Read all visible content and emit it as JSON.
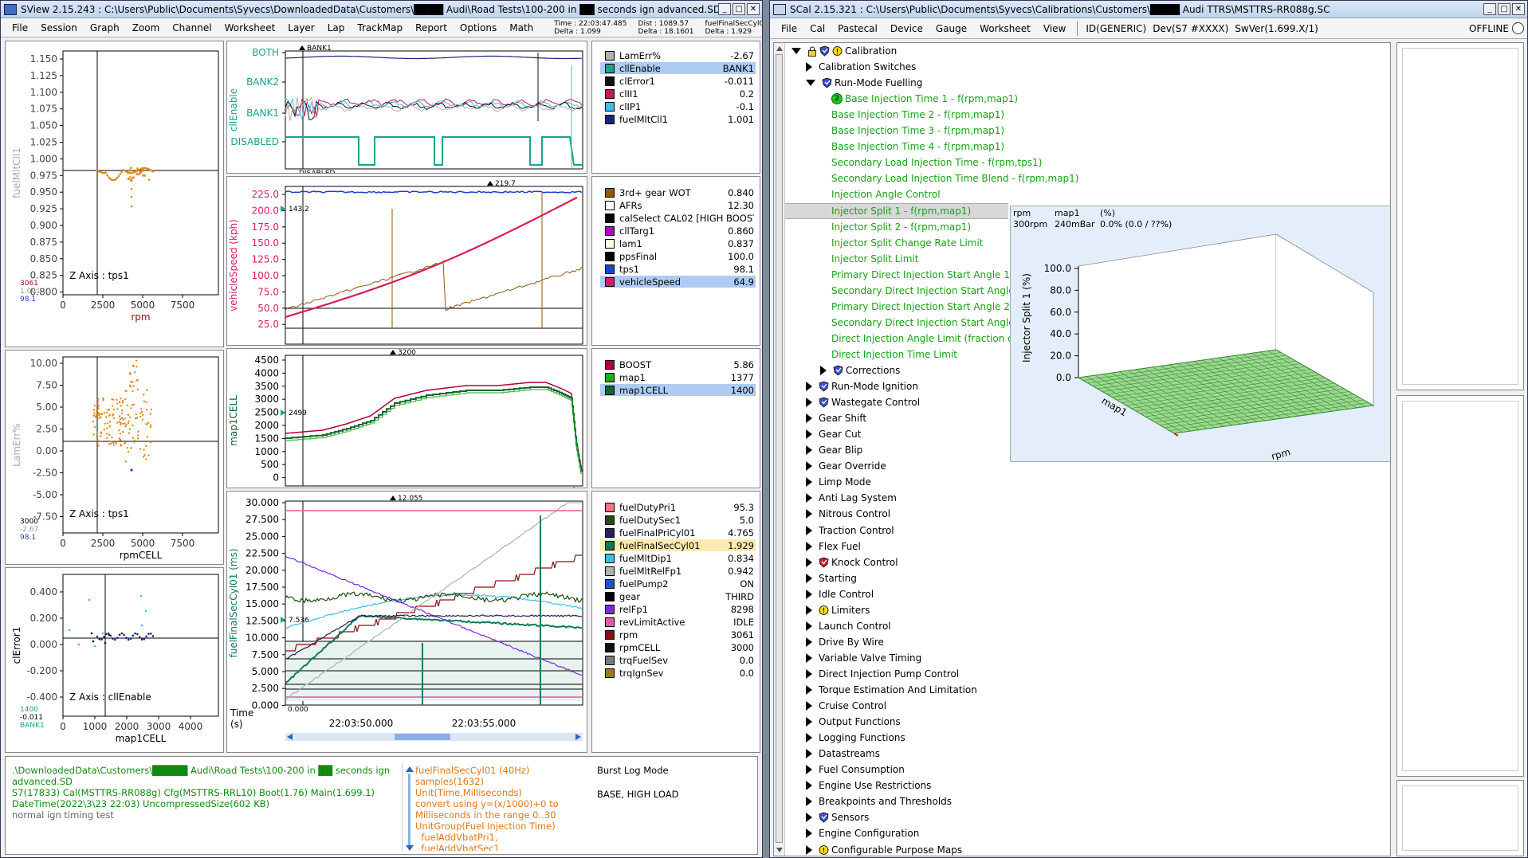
{
  "sview": {
    "title": "SView 2.15.243  :  C:\\Users\\Public\\Documents\\Syvecs\\DownloadedData\\Customers\\████ Audi\\Road Tests\\100-200 in ██ seconds ign advanced.SD",
    "menu": [
      "File",
      "Session",
      "Graph",
      "Zoom",
      "Channel",
      "Worksheet",
      "Layer",
      "Lap",
      "TrackMap",
      "Report",
      "Options",
      "Math"
    ],
    "cursor": {
      "time": "Time : 22:03:47.485",
      "time_delta": "Delta : 1.099",
      "dist": "Dist : 1089.57",
      "dist_delta": "Delta : 18.1601",
      "ch": "fuelFinalSecCyl01 : 1.929",
      "ch_delta": "Delta : 1.929"
    },
    "xy_plots": [
      {
        "ylabel": "fuelMltCll1",
        "xlabel": "rpm",
        "z": "Z Axis : tps1",
        "yticks": [
          "1.150",
          "1.125",
          "1.100",
          "1.075",
          "1.050",
          "1.025",
          "1.000",
          "0.975",
          "0.950",
          "0.925",
          "0.900",
          "0.875",
          "0.850",
          "0.825",
          "0.800"
        ],
        "xticks": [
          "0",
          "2500",
          "5000",
          "7500"
        ],
        "corner": [
          "3061",
          "1.001",
          "98.1"
        ]
      },
      {
        "ylabel": "LamErr%",
        "xlabel": "rpmCELL",
        "z": "Z Axis : tps1",
        "yticks": [
          "10.00",
          "7.50",
          "5.00",
          "2.50",
          "0.00",
          "-2.50",
          "-5.00",
          "-7.50"
        ],
        "xticks": [
          "0",
          "2500",
          "5000",
          "7500"
        ],
        "corner": [
          "3000",
          "-2.67",
          "98.1"
        ]
      },
      {
        "ylabel": "clError1",
        "xlabel": "map1CELL",
        "z": "Z Axis : cllEnable",
        "yticks": [
          "0.400",
          "0.200",
          "0.000",
          "-0.200",
          "-0.400"
        ],
        "xticks": [
          "0",
          "1000",
          "2000",
          "3000",
          "4000"
        ],
        "corner": [
          "1400",
          "-0.011",
          "BANK1"
        ]
      }
    ],
    "time_plots": [
      {
        "ylabel": "cllEnable",
        "yticks": [
          "BOTH",
          "BANK2",
          "BANK1",
          "DISABLED"
        ],
        "top_marker": "BANK1",
        "bottom_marker": "DISABLED"
      },
      {
        "ylabel": "vehicleSpeed (kph)",
        "yticks": [
          "225.0",
          "200.0",
          "175.0",
          "150.0",
          "125.0",
          "100.0",
          "75.0",
          "50.0",
          "25.0"
        ],
        "top_marker": "219.7",
        "left_marker": "143.2",
        "bottom_marker": "52.5"
      },
      {
        "ylabel": "map1CELL",
        "yticks": [
          "4500",
          "4000",
          "3500",
          "3000",
          "2500",
          "2000",
          "1500",
          "1000",
          "500",
          "0"
        ],
        "top_marker": "3200",
        "left_marker": "2499",
        "bottom_marker": "0"
      },
      {
        "ylabel": "fuelFinalSecCyl01 (ms)",
        "yticks": [
          "30.000",
          "27.500",
          "25.000",
          "22.500",
          "20.000",
          "17.500",
          "15.000",
          "12.500",
          "10.000",
          "7.500",
          "5.000",
          "2.500",
          "0.000"
        ],
        "top_marker": "12.055",
        "left_marker": "7.536",
        "bottom_marker": "0.000",
        "xticks": [
          "22:03:50.000",
          "22:03:55.000"
        ],
        "time_label": "Time\n(s)"
      }
    ],
    "channels1": [
      {
        "name": "LamErr%",
        "value": "-2.67",
        "color": "#b0b0b0"
      },
      {
        "name": "cllEnable",
        "value": "BANK1",
        "color": "#1aa38a",
        "sel": true
      },
      {
        "name": "clError1",
        "value": "-0.011",
        "color": "#111111"
      },
      {
        "name": "clII1",
        "value": "0.2",
        "color": "#c2185b"
      },
      {
        "name": "clIP1",
        "value": "-0.1",
        "color": "#3ac0e8"
      },
      {
        "name": "fuelMltCll1",
        "value": "1.001",
        "color": "#1a237e"
      }
    ],
    "channels2": [
      {
        "name": "3rd+ gear WOT",
        "value": "0.840",
        "color": "#8b5a14"
      },
      {
        "name": "AFRs",
        "value": "12.30",
        "color": "#ffffff"
      },
      {
        "name": "calSelect CAL02 [HIGH BOOST]",
        "value": "",
        "color": "#000000"
      },
      {
        "name": "cllTarg1",
        "value": "0.860",
        "color": "#b000c0"
      },
      {
        "name": "lam1",
        "value": "0.837",
        "color": "#fffbe8"
      },
      {
        "name": "ppsFinal",
        "value": "100.0",
        "color": "#000000"
      },
      {
        "name": "tps1",
        "value": "98.1",
        "color": "#1f3fd0"
      },
      {
        "name": "vehicleSpeed",
        "value": "64.9",
        "color": "#d81b60",
        "sel": true
      }
    ],
    "channels3": [
      {
        "name": "BOOST",
        "value": "5.86",
        "color": "#b0003a"
      },
      {
        "name": "map1",
        "value": "1377",
        "color": "#1faa1f"
      },
      {
        "name": "map1CELL",
        "value": "1400",
        "color": "#116633",
        "sel": true
      }
    ],
    "channels4": [
      {
        "name": "fuelDutyPri1",
        "value": "95.3",
        "color": "#ff6f8a"
      },
      {
        "name": "fuelDutySec1",
        "value": "5.0",
        "color": "#214d14"
      },
      {
        "name": "fuelFinalPriCyl01",
        "value": "4.765",
        "color": "#26205a"
      },
      {
        "name": "fuelFinalSecCyl01",
        "value": "1.929",
        "color": "#0f7a5a",
        "selY": true
      },
      {
        "name": "fuelMltDip1",
        "value": "0.834",
        "color": "#3ac0e8"
      },
      {
        "name": "fuelMltRelFp1",
        "value": "0.942",
        "color": "#b0b0b0"
      },
      {
        "name": "fuelPump2",
        "value": "ON",
        "color": "#1d55c4"
      },
      {
        "name": "gear",
        "value": "THIRD",
        "color": "#000000"
      },
      {
        "name": "relFp1",
        "value": "8298",
        "color": "#7c2ad8"
      },
      {
        "name": "revLimitActive",
        "value": "IDLE",
        "color": "#e05aa6"
      },
      {
        "name": "rpm",
        "value": "3061",
        "color": "#8a1010"
      },
      {
        "name": "rpmCELL",
        "value": "3000",
        "color": "#111111"
      },
      {
        "name": "trqFuelSev",
        "value": "0.0",
        "color": "#7a7a7a"
      },
      {
        "name": "trqIgnSev",
        "value": "0.0",
        "color": "#9a7a10"
      }
    ],
    "info1": ".\\DownloadedData\\Customers\\█████ Audi\\Road Tests\\100-200 in ██ seconds ign\nadvanced.SD\nS7(17833) Cal(MSTTRS-RR088g) Cfg(MSTTRS-RRL10) Boot(1.76) Main(1.699.1)\nDateTime(2022\\3\\23 22:03) UncompressedSize(602 KB)",
    "info1_note": "normal ign timing test",
    "info2": "fuelFinalSecCyl01 (40Hz)\nsamples(1632)\nUnit(Time,Milliseconds)\nconvert using y=(x/1000)+0 to\nMilliseconds in the range 0..30\nUnitGroup(Fuel Injection Time)\n  fuelAddVbatPri1,\n  fuelAddVbatSec1",
    "info3a": "Burst Log Mode",
    "info3b": "BASE, HIGH LOAD"
  },
  "scal": {
    "title": "SCal 2.15.321  :  C:\\Users\\Public\\Documents\\Syvecs\\Calibrations\\Customers\\████ Audi TTRS\\MSTTRS-RR088g.SC",
    "menu": [
      "File",
      "Cal",
      "Pastecal",
      "Device",
      "Gauge",
      "Worksheet",
      "View"
    ],
    "ids": [
      "ID(GENERIC)",
      "Dev(S7 #XXXX)",
      "SwVer(1.699.X/1)"
    ],
    "offline": "OFFLINE",
    "tree": [
      {
        "label": "Calibration",
        "level": 0,
        "tri": "open",
        "icons": "lock-shield-warn",
        "color": "#000"
      },
      {
        "label": "Calibration Switches",
        "level": 1,
        "tri": "closed",
        "color": "#000"
      },
      {
        "label": "Run-Mode Fuelling",
        "level": 1,
        "tri": "open",
        "icons": "shield",
        "color": "#000"
      },
      {
        "label": "Base Injection Time 1 - f(rpm,map1)",
        "level": 3,
        "badge": "2",
        "color": "#15a315"
      },
      {
        "label": "Base Injection Time 2 - f(rpm,map1)",
        "level": 3,
        "color": "#15a315"
      },
      {
        "label": "Base Injection Time 3 - f(rpm,map1)",
        "level": 3,
        "color": "#15a315"
      },
      {
        "label": "Base Injection Time 4 - f(rpm,map1)",
        "level": 3,
        "color": "#15a315"
      },
      {
        "label": "Secondary Load Injection Time - f(rpm,tps1)",
        "level": 3,
        "color": "#15a315"
      },
      {
        "label": "Secondary Load Injection Time Blend - f(rpm,map1)",
        "level": 3,
        "color": "#15a315"
      },
      {
        "label": "Injection Angle Control",
        "level": 3,
        "color": "#15a315"
      },
      {
        "label": "Injector Split 1 - f(rpm,map1)",
        "level": 3,
        "color": "#15a315",
        "sel": true
      },
      {
        "label": "Injector Split 2 - f(rpm,map1)",
        "level": 3,
        "color": "#15a315"
      },
      {
        "label": "Injector Split Change Rate Limit",
        "level": 3,
        "color": "#15a315"
      },
      {
        "label": "Injector Split Limit",
        "level": 3,
        "color": "#15a315"
      },
      {
        "label": "Primary Direct Injection Start Angle 1 (",
        "level": 3,
        "color": "#15a315"
      },
      {
        "label": "Secondary Direct Injection Start Angle",
        "level": 3,
        "color": "#15a315"
      },
      {
        "label": "Primary Direct Injection Start Angle 2 (",
        "level": 3,
        "color": "#15a315"
      },
      {
        "label": "Secondary Direct Injection Start Angle",
        "level": 3,
        "color": "#15a315"
      },
      {
        "label": "Direct Injection Angle Limit (fraction of",
        "level": 3,
        "color": "#15a315"
      },
      {
        "label": "Direct Injection Time Limit",
        "level": 3,
        "color": "#15a315"
      },
      {
        "label": "Corrections",
        "level": 2,
        "tri": "closed",
        "icons": "shield",
        "color": "#000"
      },
      {
        "label": "Run-Mode Ignition",
        "level": 1,
        "tri": "closed",
        "icons": "shield",
        "color": "#000"
      },
      {
        "label": "Wastegate Control",
        "level": 1,
        "tri": "closed",
        "icons": "shield",
        "color": "#000"
      },
      {
        "label": "Gear Shift",
        "level": 1,
        "tri": "closed",
        "color": "#000"
      },
      {
        "label": "Gear Cut",
        "level": 1,
        "tri": "closed",
        "color": "#000"
      },
      {
        "label": "Gear Blip",
        "level": 1,
        "tri": "closed",
        "color": "#000"
      },
      {
        "label": "Gear Override",
        "level": 1,
        "tri": "closed",
        "color": "#000"
      },
      {
        "label": "Limp Mode",
        "level": 1,
        "tri": "closed",
        "color": "#000"
      },
      {
        "label": "Anti Lag System",
        "level": 1,
        "tri": "closed",
        "color": "#000"
      },
      {
        "label": "Nitrous Control",
        "level": 1,
        "tri": "closed",
        "color": "#000"
      },
      {
        "label": "Traction Control",
        "level": 1,
        "tri": "closed",
        "color": "#000"
      },
      {
        "label": "Flex Fuel",
        "level": 1,
        "tri": "closed",
        "color": "#000"
      },
      {
        "label": "Knock Control",
        "level": 1,
        "tri": "closed",
        "icons": "shield-red",
        "color": "#000"
      },
      {
        "label": "Starting",
        "level": 1,
        "tri": "closed",
        "color": "#000"
      },
      {
        "label": "Idle Control",
        "level": 1,
        "tri": "closed",
        "color": "#000"
      },
      {
        "label": "Limiters",
        "level": 1,
        "tri": "closed",
        "icons": "warn",
        "color": "#000"
      },
      {
        "label": "Launch Control",
        "level": 1,
        "tri": "closed",
        "color": "#000"
      },
      {
        "label": "Drive By Wire",
        "level": 1,
        "tri": "closed",
        "color": "#000"
      },
      {
        "label": "Variable Valve Timing",
        "level": 1,
        "tri": "closed",
        "color": "#000"
      },
      {
        "label": "Direct Injection Pump Control",
        "level": 1,
        "tri": "closed",
        "color": "#000"
      },
      {
        "label": "Torque Estimation And Limitation",
        "level": 1,
        "tri": "closed",
        "color": "#000"
      },
      {
        "label": "Cruise Control",
        "level": 1,
        "tri": "closed",
        "color": "#000"
      },
      {
        "label": "Output Functions",
        "level": 1,
        "tri": "closed",
        "color": "#000"
      },
      {
        "label": "Logging Functions",
        "level": 1,
        "tri": "closed",
        "color": "#000"
      },
      {
        "label": "Datastreams",
        "level": 1,
        "tri": "closed",
        "color": "#000"
      },
      {
        "label": "Fuel Consumption",
        "level": 1,
        "tri": "closed",
        "color": "#000"
      },
      {
        "label": "Engine Use Restrictions",
        "level": 1,
        "tri": "closed",
        "color": "#000"
      },
      {
        "label": "Breakpoints and Thresholds",
        "level": 1,
        "tri": "closed",
        "color": "#000"
      },
      {
        "label": "Sensors",
        "level": 1,
        "tri": "closed",
        "icons": "shield",
        "color": "#000"
      },
      {
        "label": "Engine Configuration",
        "level": 1,
        "tri": "closed",
        "color": "#000"
      },
      {
        "label": "Configurable Purpose Maps",
        "level": 1,
        "tri": "closed",
        "icons": "warn",
        "color": "#000"
      }
    ],
    "popup": {
      "col_rpm": "rpm",
      "col_map": "map1",
      "col_pct": "(%)",
      "val_rpm": "300rpm",
      "val_map": "240mBar",
      "val_pct": "0.0% (0.0 / ??%)",
      "zlabel": "Injector Split 1 (%)",
      "zticks": [
        "100.0",
        "80.0",
        "60.0",
        "40.0",
        "20.0",
        "0.0"
      ],
      "x_axis": "rpm",
      "y_axis": "map1"
    }
  }
}
